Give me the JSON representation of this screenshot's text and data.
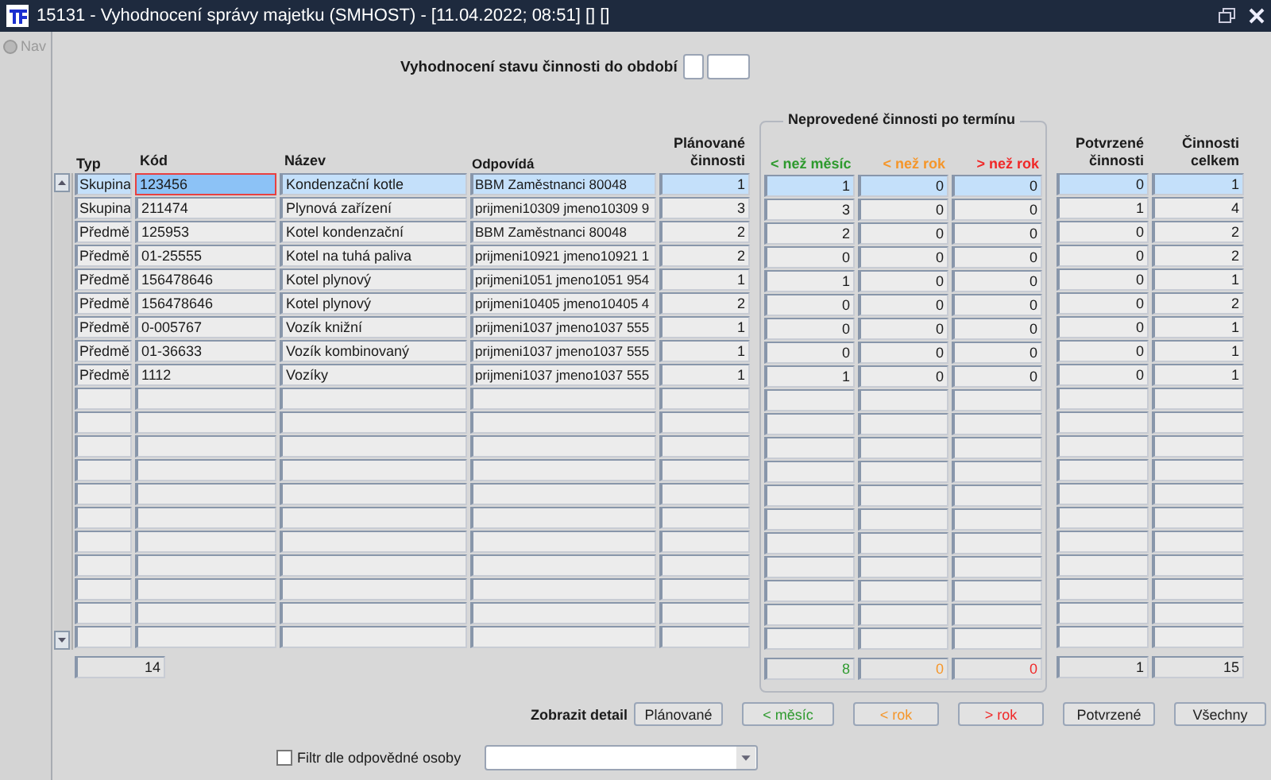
{
  "window": {
    "title": "15131 - Vyhodnocení správy majetku (SMHOST) - [11.04.2022; 08:51] [] []"
  },
  "nav": {
    "label": "Nav",
    "disabled": true
  },
  "period": {
    "label": "Vyhodnocení stavu činnosti do období"
  },
  "table": {
    "columns": [
      "Typ",
      "Kód",
      "Název",
      "Odpovídá",
      "Plánované činnosti"
    ],
    "group": {
      "title": "Neprovedené činnosti po termínu",
      "columns": [
        {
          "label": "< než měsíc",
          "color": "#2e9a2e"
        },
        {
          "label": "< než rok",
          "color": "#f5962a"
        },
        {
          "label": "> než rok",
          "color": "#f02828"
        }
      ]
    },
    "right_columns": [
      "Potvrzené činnosti",
      "Činnosti celkem"
    ],
    "rows": [
      {
        "typ": "Skupina",
        "kod": "123456",
        "nazev": "Kondenzační kotle",
        "odpovida": "BBM Zaměstnanci 80048",
        "planovane": "1",
        "overdue": [
          "1",
          "0",
          "0"
        ],
        "potvrzene": "0",
        "celkem": "1",
        "selected": true,
        "focused": true
      },
      {
        "typ": "Skupina",
        "kod": "211474",
        "nazev": "Plynová zařízení",
        "odpovida": "prijmeni10309 jmeno10309 9",
        "planovane": "3",
        "overdue": [
          "3",
          "0",
          "0"
        ],
        "potvrzene": "1",
        "celkem": "4",
        "selected": false,
        "focused": false
      },
      {
        "typ": "Předmě",
        "kod": "125953",
        "nazev": "Kotel kondenzační",
        "odpovida": "BBM Zaměstnanci 80048",
        "planovane": "2",
        "overdue": [
          "2",
          "0",
          "0"
        ],
        "potvrzene": "0",
        "celkem": "2",
        "selected": false,
        "focused": false
      },
      {
        "typ": "Předmě",
        "kod": "01-25555",
        "nazev": "Kotel na tuhá paliva",
        "odpovida": "prijmeni10921 jmeno10921 1",
        "planovane": "2",
        "overdue": [
          "0",
          "0",
          "0"
        ],
        "potvrzene": "0",
        "celkem": "2",
        "selected": false,
        "focused": false
      },
      {
        "typ": "Předmě",
        "kod": "156478646",
        "nazev": "Kotel plynový",
        "odpovida": "prijmeni1051 jmeno1051 954",
        "planovane": "1",
        "overdue": [
          "1",
          "0",
          "0"
        ],
        "potvrzene": "0",
        "celkem": "1",
        "selected": false,
        "focused": false
      },
      {
        "typ": "Předmě",
        "kod": "156478646",
        "nazev": "Kotel plynový",
        "odpovida": "prijmeni10405 jmeno10405 4",
        "planovane": "2",
        "overdue": [
          "0",
          "0",
          "0"
        ],
        "potvrzene": "0",
        "celkem": "2",
        "selected": false,
        "focused": false
      },
      {
        "typ": "Předmě",
        "kod": "0-005767",
        "nazev": "Vozík knižní",
        "odpovida": "prijmeni1037 jmeno1037 555",
        "planovane": "1",
        "overdue": [
          "0",
          "0",
          "0"
        ],
        "potvrzene": "0",
        "celkem": "1",
        "selected": false,
        "focused": false
      },
      {
        "typ": "Předmě",
        "kod": "01-36633",
        "nazev": "Vozík kombinovaný",
        "odpovida": "prijmeni1037 jmeno1037 555",
        "planovane": "1",
        "overdue": [
          "0",
          "0",
          "0"
        ],
        "potvrzene": "0",
        "celkem": "1",
        "selected": false,
        "focused": false
      },
      {
        "typ": "Předmě",
        "kod": "1112",
        "nazev": "Vozíky",
        "odpovida": "prijmeni1037 jmeno1037 555",
        "planovane": "1",
        "overdue": [
          "1",
          "0",
          "0"
        ],
        "potvrzene": "0",
        "celkem": "1",
        "selected": false,
        "focused": false
      }
    ],
    "totals": {
      "planovane": "14",
      "overdue": [
        "8",
        "0",
        "0"
      ],
      "potvrzene": "1",
      "celkem": "15"
    }
  },
  "detail": {
    "label": "Zobrazit detail",
    "buttons": [
      {
        "label": "Plánované",
        "color": "#202020"
      },
      {
        "label": "< měsíc",
        "color": "#2e9a2e"
      },
      {
        "label": "< rok",
        "color": "#f5962a"
      },
      {
        "label": "> rok",
        "color": "#f02828"
      },
      {
        "label": "Potvrzené",
        "color": "#202020"
      },
      {
        "label": "Všechny",
        "color": "#202020"
      }
    ]
  },
  "filter": {
    "label": "Filtr dle odpovědné osoby",
    "checked": false
  }
}
